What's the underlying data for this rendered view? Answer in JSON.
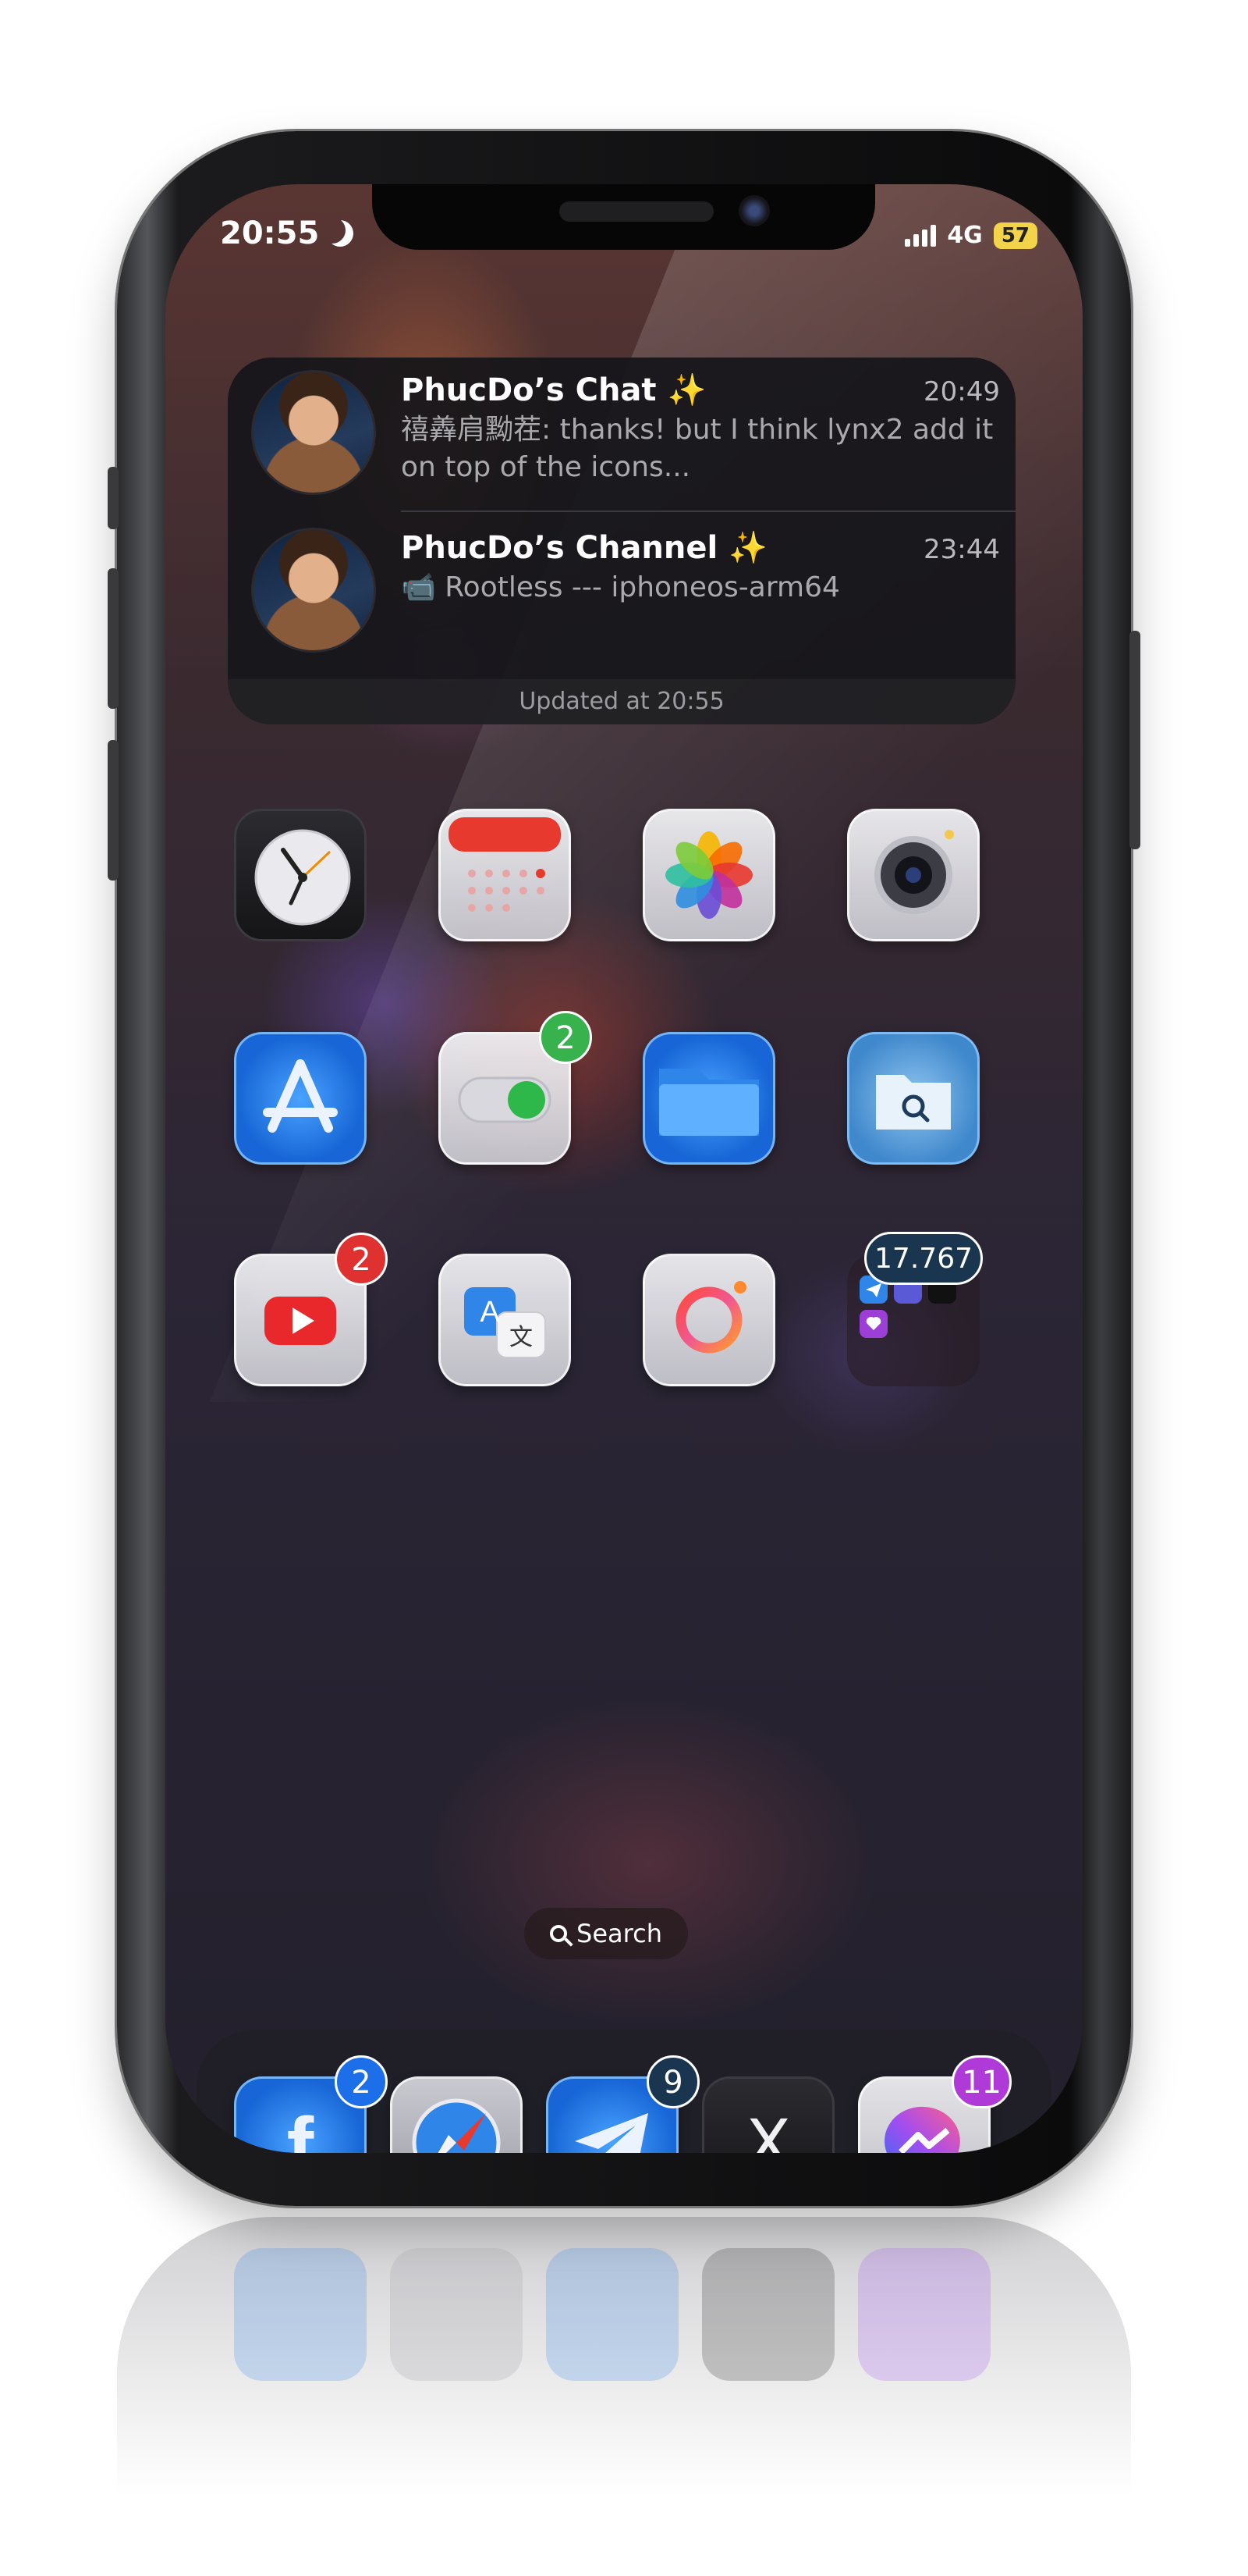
{
  "status_bar": {
    "time": "20:55",
    "network": "4G",
    "battery": "57"
  },
  "widget": {
    "chats": [
      {
        "title": "PhucDo’s Chat ✨",
        "time": "20:49",
        "message": "禧羴肩黝茬: thanks! but I think lynx2 add it on top of the icons..."
      },
      {
        "title": "PhucDo’s Channel ✨",
        "time": "23:44",
        "message": "📹 Rootless --- iphoneos-arm64"
      }
    ],
    "footer": "Updated at 20:55"
  },
  "badges": {
    "toggle": "2",
    "youtube": "2",
    "folder": "17.767",
    "facebook": "2",
    "telegram": "9",
    "messenger": "11"
  },
  "badge_colors": {
    "green": "#37b24d",
    "red": "#e03131",
    "blue": "#1c6fe8",
    "navy": "#1a3550",
    "purple": "#b03ad8"
  },
  "icons": [
    "clock-icon",
    "calendar-icon",
    "photos-icon",
    "camera-icon",
    "app-store-icon",
    "settings-toggle-icon",
    "files-icon",
    "finder-icon",
    "youtube-icon",
    "translate-icon",
    "instagram-ring-icon",
    "app-folder",
    "facebook-icon",
    "safari-icon",
    "telegram-icon",
    "x-icon",
    "messenger-icon"
  ],
  "search": {
    "label": "Search"
  },
  "translate": {
    "a": "A",
    "wen": "文"
  },
  "facebook": {
    "f": "f"
  },
  "x": {
    "x": "X"
  }
}
